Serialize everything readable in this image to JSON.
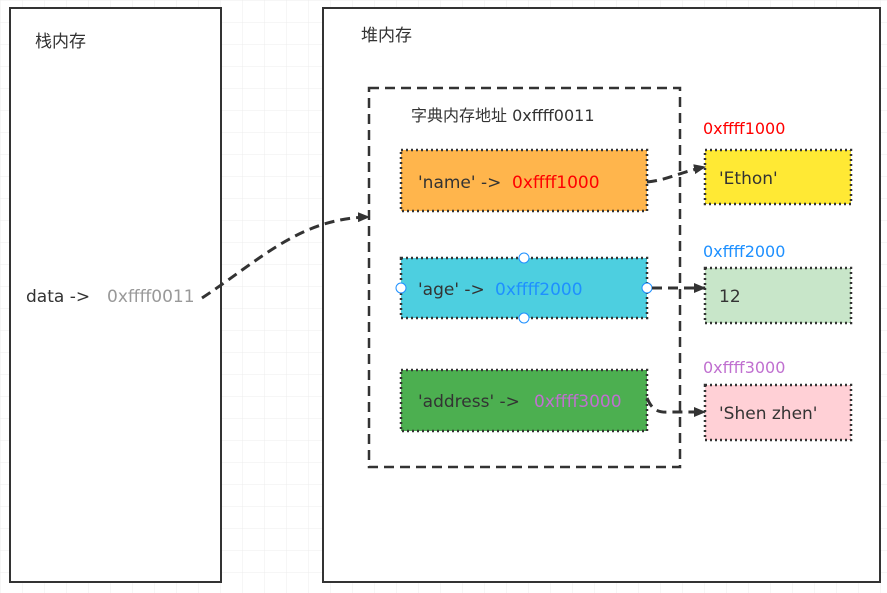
{
  "stack": {
    "title": "栈内存",
    "var_name": "data ->",
    "var_addr": "0xffff0011"
  },
  "heap": {
    "title": "堆内存",
    "dict_label": "字典内存地址  0xffff0011",
    "entries": [
      {
        "key": "'name' ->",
        "addr": "0xffff1000",
        "value": "'Ethon'",
        "addr_color": "#ff0000",
        "key_fill": "#ffb54c",
        "value_fill": "#ffe934"
      },
      {
        "key": "'age' ->",
        "addr": "0xffff2000",
        "value": "12",
        "addr_color": "#1e90ff",
        "key_fill": "#4dcfe0",
        "value_fill": "#c8e6c9"
      },
      {
        "key": "'address' ->",
        "addr": "0xffff3000",
        "value": "'Shen zhen'",
        "addr_color": "#c070d0",
        "key_fill": "#4caf50",
        "value_fill": "#ffd0d6"
      }
    ]
  }
}
